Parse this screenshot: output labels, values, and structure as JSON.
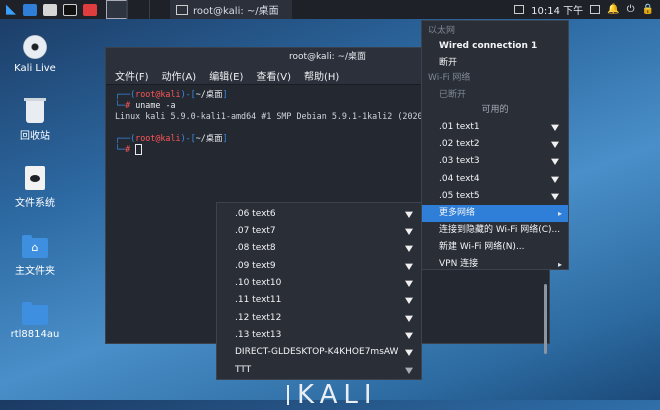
{
  "taskbar": {
    "task_title": "root@kali: ~/桌面",
    "clock": "10:14 下午"
  },
  "desktop_icons": [
    {
      "label": "Kali Live",
      "icon": "cd-icon"
    },
    {
      "label": "回收站",
      "icon": "trash-icon"
    },
    {
      "label": "文件系统",
      "icon": "drive-icon"
    },
    {
      "label": "主文件夹",
      "icon": "home-folder-icon"
    },
    {
      "label": "rtl8814au",
      "icon": "folder-icon"
    }
  ],
  "terminal": {
    "title": "root@kali: ~/桌面",
    "menu": [
      "文件(F)",
      "动作(A)",
      "编辑(E)",
      "查看(V)",
      "帮助(H)"
    ],
    "prompt_user": "root@kali",
    "prompt_dir": "~/桌面",
    "command": "uname -a",
    "output": "Linux kali 5.9.0-kali1-amd64 #1 SMP Debian 5.9.1-1kali2 (2020-10-2"
  },
  "network_menu": {
    "ethernet_header": "以太网",
    "wired_connection": "Wired connection 1",
    "disconnect": "断开",
    "wifi_header": "Wi-Fi 网络",
    "wifi_status": "已断开",
    "available": "可用的",
    "networks": [
      ".01 text1",
      ".02 text2",
      ".03 text3",
      ".04 text4",
      ".05 text5"
    ],
    "more_networks": "更多网络",
    "connect_hidden": "连接到隐藏的 Wi-Fi 网络(C)...",
    "new_wifi": "新建 Wi-Fi 网络(N)...",
    "vpn": "VPN 连接"
  },
  "submenu": {
    "networks": [
      ".06 text6",
      ".07 text7",
      ".08 text8",
      ".09 text9",
      ".10 text10",
      ".11 text11",
      ".12 text12",
      ".13 text13",
      "DIRECT-GLDESKTOP-K4KHOE7msAW",
      "TTT"
    ]
  },
  "wallpaper_text": "KALI"
}
